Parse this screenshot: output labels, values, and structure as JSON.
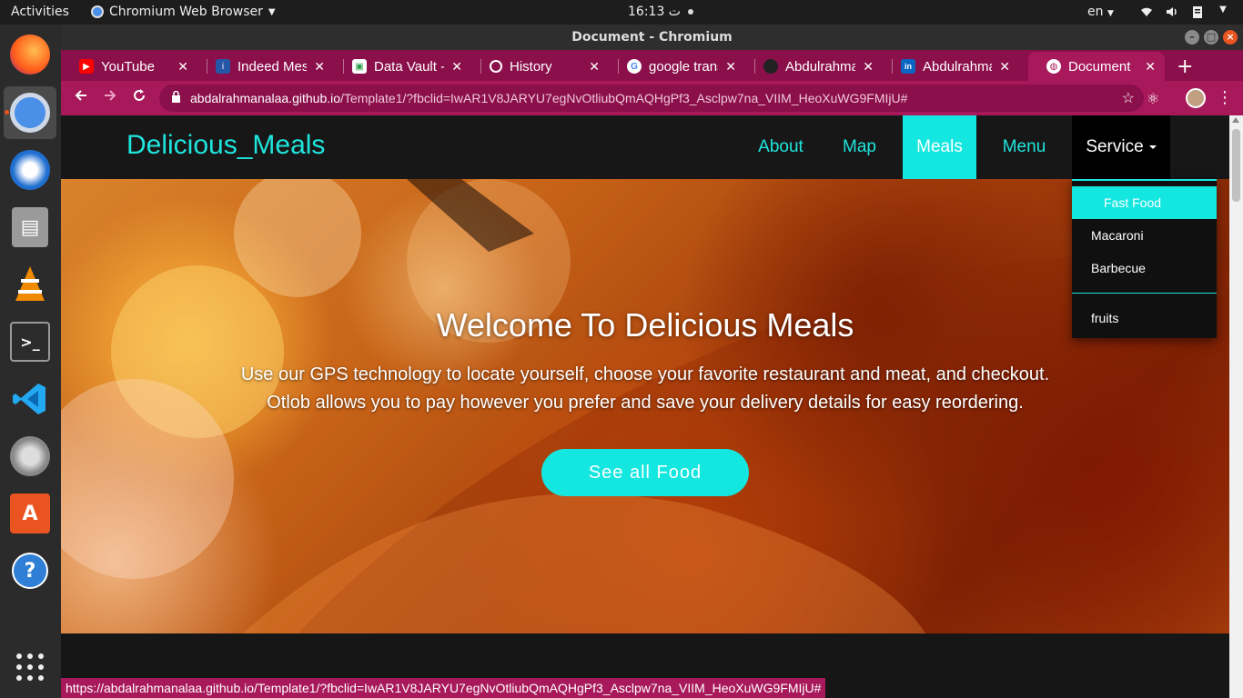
{
  "topbar": {
    "activities": "Activities",
    "app_name": "Chromium Web Browser",
    "clock": "16:13 ت",
    "lang": "en"
  },
  "window": {
    "title": "Document - Chromium"
  },
  "tabs": [
    {
      "title": "YouTube",
      "icon": "youtube-icon",
      "color": "#ff0000"
    },
    {
      "title": "Indeed Mess",
      "icon": "indeed-icon",
      "color": "#2557a7"
    },
    {
      "title": "Data Vault - f",
      "icon": "data-vault-icon",
      "color": "#ffffff"
    },
    {
      "title": "History",
      "icon": "history-icon",
      "color": "#ffffff"
    },
    {
      "title": "google trans",
      "icon": "google-icon",
      "color": "#ffffff"
    },
    {
      "title": "Abdulrahma",
      "icon": "github-icon",
      "color": "#222222"
    },
    {
      "title": "Abdulrahma",
      "icon": "linkedin-icon",
      "color": "#0a66c2"
    },
    {
      "title": "Document",
      "icon": "globe-icon",
      "color": "#ffffff"
    }
  ],
  "address": {
    "host": "abdalrahmanalaa.github.io",
    "path": "/Template1/?fbclid=IwAR1V8JARYU7egNvOtliubQmAQHgPf3_Asclpw7na_VIIM_HeoXuWG9FMIjU#"
  },
  "site": {
    "brand": "Delicious_Meals",
    "nav": [
      "About",
      "Map",
      "Meals",
      "Menu",
      "Service"
    ],
    "active_nav": "Meals",
    "dropdown": {
      "items": [
        "Fast Food",
        "Macaroni",
        "Barbecue"
      ],
      "after_divider": "fruits"
    },
    "hero": {
      "title": "Welcome To Delicious Meals",
      "line1": "Use our GPS technology to locate yourself, choose your favorite restaurant and meat, and checkout.",
      "line2": "Otlob allows you to pay however you prefer and save your delivery details for easy reordering.",
      "button": "See all Food"
    }
  },
  "status_url": "https://abdalrahmanalaa.github.io/Template1/?fbclid=IwAR1V8JARYU7egNvOtliubQmAQHgPf3_Asclpw7na_VIIM_HeoXuWG9FMIjU#",
  "colors": {
    "accent": "#14e6e0",
    "browser_theme": "#a8195b",
    "tabstrip": "#8b0f4a"
  }
}
